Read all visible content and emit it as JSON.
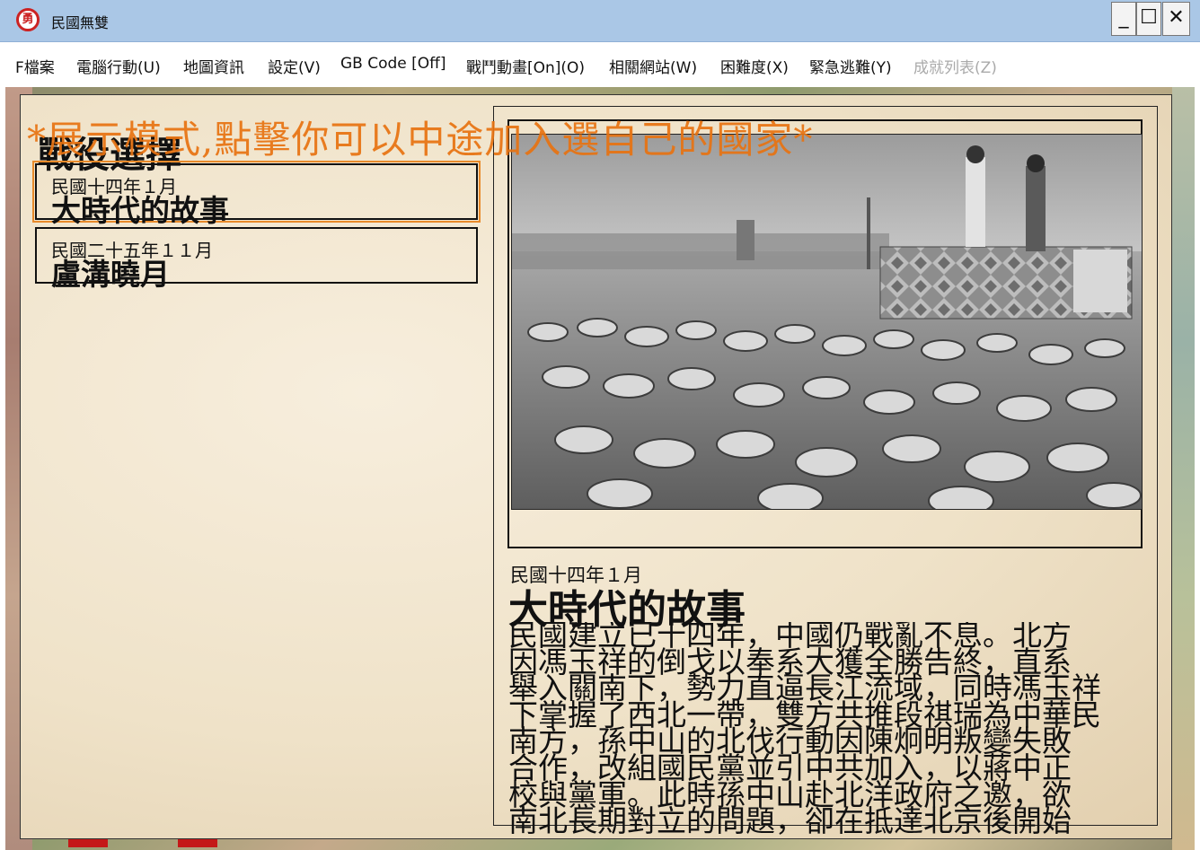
{
  "window": {
    "title": "民國無雙",
    "icon_glyph": "勇",
    "minimize_glyph": "_",
    "maximize_glyph": "☐",
    "close_glyph": "✕"
  },
  "menu": {
    "items": [
      {
        "label": "F檔案"
      },
      {
        "label": "電腦行動(U)"
      },
      {
        "label": "地圖資訊"
      },
      {
        "label": "設定(V)"
      },
      {
        "label": "GB Code [Off]"
      },
      {
        "label": "戰鬥動畫[On](O)"
      },
      {
        "label": "相關網站(W)"
      },
      {
        "label": "困難度(X)"
      },
      {
        "label": "緊急逃難(Y)"
      },
      {
        "label": "成就列表(Z)",
        "disabled": true
      }
    ]
  },
  "notice": "*展示模式,點擊你可以中途加入選自己的國家*",
  "scenario_panel": {
    "title": "戰役選擇",
    "scenarios": [
      {
        "date": "民國十四年１月",
        "name": "大時代的故事",
        "selected": true
      },
      {
        "date": "民國二十五年１１月",
        "name": "盧溝曉月",
        "selected": false
      }
    ]
  },
  "detail": {
    "date": "民國十四年１月",
    "title": "大時代的故事",
    "body_lines": [
      "民國建立已十四年，中國仍戰亂不息。北方",
      "因馮玉祥的倒戈以奉系大獲全勝告終，直系",
      "舉入關南下，勢力直逼長江流域，同時馮玉祥",
      "下掌握了西北一帶，雙方共推段祺瑞為中華民",
      "南方，孫中山的北伐行動因陳炯明叛變失敗",
      "合作，改組國民黨並引中共加入，以蔣中正",
      "校與黨軍。此時孫中山赴北洋政府之邀，欲",
      "南北長期對立的問題，卻在抵達北京後開始"
    ]
  },
  "colors": {
    "notice": "#e87311",
    "selection_outline": "#e88a2a",
    "titlebar": "#aac7e6"
  }
}
